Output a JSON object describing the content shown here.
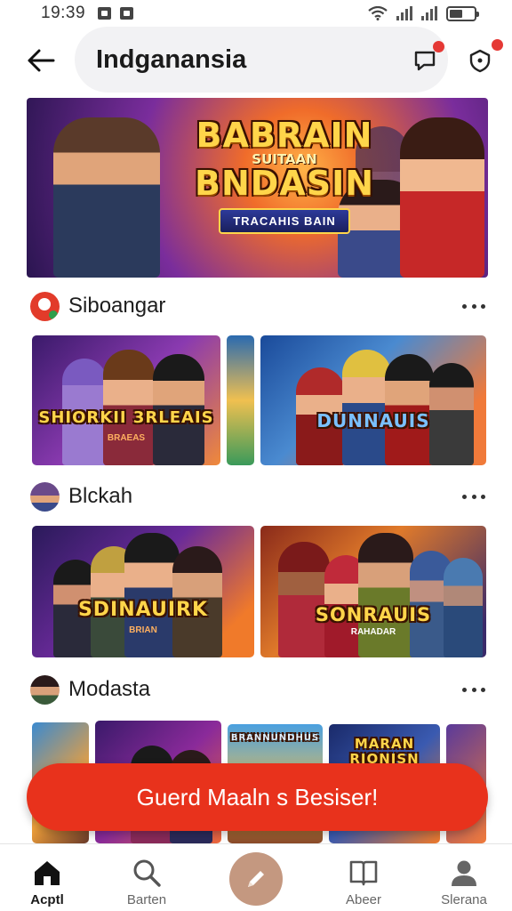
{
  "status_bar": {
    "time": "19:39"
  },
  "header": {
    "title": "Indganansia"
  },
  "hero": {
    "title_line1": "BABRAIN",
    "subtitle": "SUITAAN",
    "title_line2": "BNDASIN",
    "tag": "TRACAHIS BAIN"
  },
  "sections": [
    {
      "name": "Siboangar",
      "tiles": [
        {
          "logo": "SHIORKII 3RLEAIS",
          "sub": "BRAEAS"
        },
        {
          "logo": "",
          "sub": ""
        },
        {
          "logo": "DUNNAUIS",
          "sub": ""
        }
      ]
    },
    {
      "name": "Blckah",
      "tiles": [
        {
          "logo": "SDINAUIRK",
          "sub": "BRIAN"
        },
        {
          "logo": "SONRAUIS",
          "sub": "RAHADAR"
        }
      ]
    },
    {
      "name": "Modasta",
      "tiles": [
        {
          "logo": "",
          "sub": ""
        },
        {
          "logo": "",
          "sub": ""
        },
        {
          "logo": "BRANNUNDHUS",
          "sub": ""
        },
        {
          "logo": "MARAN RIONISN",
          "sub": ""
        },
        {
          "logo": "",
          "sub": ""
        }
      ]
    }
  ],
  "cta": {
    "label": "Guerd Maaln s Besiser!"
  },
  "bottom_nav": [
    {
      "label": "Acptl",
      "icon": "home-icon",
      "active": true
    },
    {
      "label": "Barten",
      "icon": "search-icon"
    },
    {
      "label": "Abeer",
      "icon": "book-icon"
    },
    {
      "label": "Slerana",
      "icon": "profile-icon"
    }
  ],
  "colors": {
    "accent": "#e8321c",
    "fab": "#c49880",
    "badge": "#e53935"
  },
  "icons": {
    "back": "arrow-left-icon",
    "message": "message-icon",
    "shield": "shield-icon",
    "more": "more-dots-icon",
    "create": "pencil-icon"
  }
}
